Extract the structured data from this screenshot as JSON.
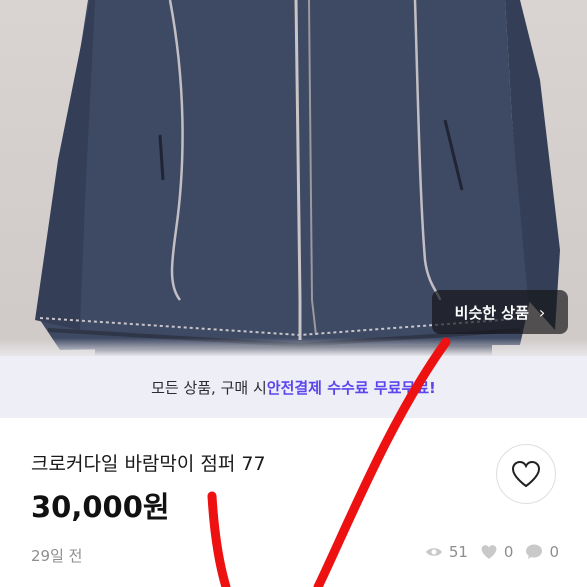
{
  "product": {
    "similar_button_label": "비슷한 상품",
    "title": "크로커다일 바람막이 점퍼 77",
    "price": "30,000원",
    "posted": "29일 전"
  },
  "banner": {
    "prefix": "모든 상품, 구매 시 ",
    "highlight": "안전결제 수수료 무료",
    "suffix": "무료!"
  },
  "stats": {
    "views": "51",
    "likes": "0",
    "chats": "0"
  },
  "icons": {
    "similar": "chevron-right-icon",
    "like": "heart-icon",
    "views": "eye-icon",
    "likes": "heart-icon",
    "chats": "chat-bubble-icon"
  },
  "colors": {
    "accent": "#5b45ee",
    "annotation": "#ee1111",
    "jacket": "#3f4a63"
  }
}
